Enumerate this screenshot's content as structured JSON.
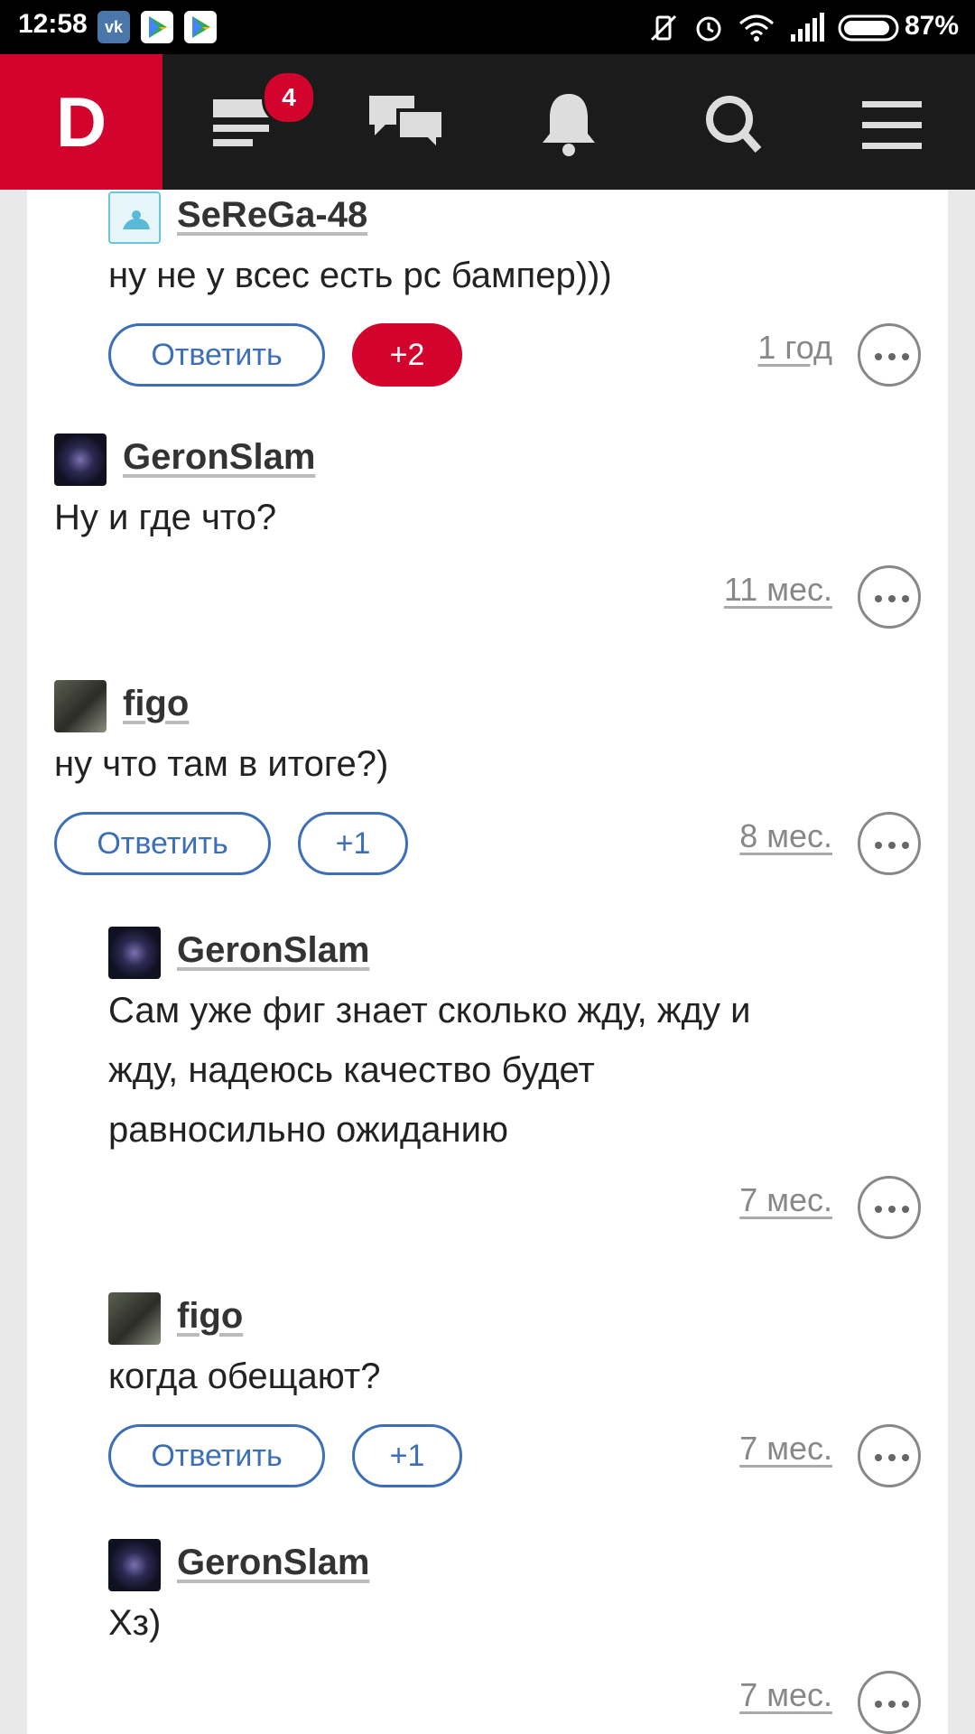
{
  "status_bar": {
    "time": "12:58",
    "battery": "87%",
    "vk_label": "vk",
    "icons": [
      "vk-icon",
      "play-store-icon",
      "play-store-icon",
      "mute-vibrate-icon",
      "alarm-icon",
      "wifi-icon",
      "signal-icon",
      "battery-icon"
    ]
  },
  "navbar": {
    "logo": "D",
    "feed_badge": "4",
    "icons": [
      "feed-icon",
      "chat-icon",
      "bell-icon",
      "search-icon",
      "menu-icon"
    ]
  },
  "colors": {
    "accent": "#d2042d",
    "link_blue": "#3d6fb8",
    "navbar_bg": "#1b1b1b"
  },
  "comments": [
    {
      "author": "SeReGa-48",
      "text": "ну не у всес есть рс бампер)))",
      "reply_label": "Ответить",
      "vote": "+2",
      "time": "1 год"
    },
    {
      "author": "GeronSlam",
      "text": "Ну и где что?",
      "time": "11 мес."
    },
    {
      "author": "figo",
      "text": "ну что там в итоге?)",
      "reply_label": "Ответить",
      "vote": "+1",
      "time": "8 мес."
    },
    {
      "author": "GeronSlam",
      "text_lines": [
        "Сам уже фиг знает сколько жду, жду и",
        "жду, надеюсь качество будет",
        "равносильно ожиданию"
      ],
      "time": "7 мес."
    },
    {
      "author": "figo",
      "text": "когда обещают?",
      "reply_label": "Ответить",
      "vote": "+1",
      "time": "7 мес."
    },
    {
      "author": "GeronSlam",
      "text": "Хз)",
      "time": "7 мес."
    }
  ]
}
